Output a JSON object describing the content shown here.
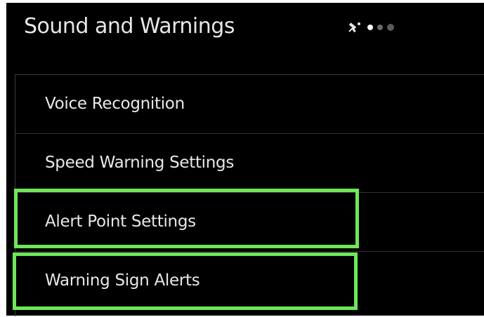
{
  "header": {
    "title": "Sound and Warnings",
    "status_icon": "satellite-icon",
    "page_dots": 3,
    "active_dot": 0
  },
  "menu": {
    "items": [
      {
        "label": "Voice Recognition",
        "highlighted": false
      },
      {
        "label": "Speed Warning Settings",
        "highlighted": false
      },
      {
        "label": "Alert Point Settings",
        "highlighted": true
      },
      {
        "label": "Warning Sign Alerts",
        "highlighted": true
      }
    ]
  },
  "colors": {
    "background": "#000000",
    "text": "#e8e8e8",
    "highlight": "#6fe65a",
    "divider": "#333333"
  }
}
